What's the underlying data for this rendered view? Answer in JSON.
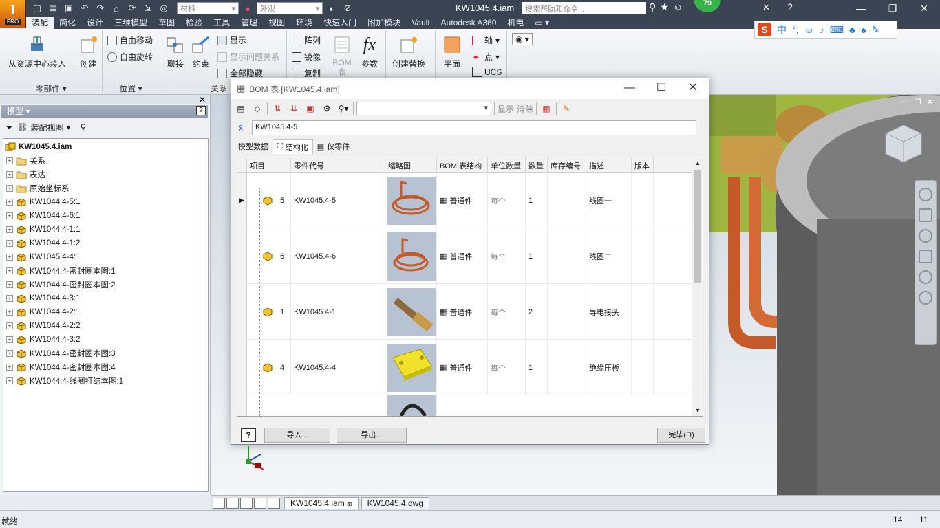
{
  "app": {
    "logo_letter": "I",
    "logo_pro": "PRO",
    "doc_title": "KW1045.4.iam",
    "search_placeholder": "搜索帮助和命令...",
    "badge": "79",
    "material_combo": "材料",
    "appearance_combo": "外观"
  },
  "menu": [
    "装配",
    "简化",
    "设计",
    "三维模型",
    "草图",
    "检验",
    "工具",
    "管理",
    "视图",
    "环境",
    "快速入门",
    "附加模块",
    "Vault",
    "Autodesk A360",
    "机电"
  ],
  "ribbon": {
    "place_from_center": "从资源中心装入",
    "create": "创建",
    "free_move": "自由移动",
    "free_rotate": "自由旋转",
    "joint": "联接",
    "constrain": "约束",
    "show": "显示",
    "show_problem": "显示问题关系",
    "hide_all": "全部隐藏",
    "pattern": "阵列",
    "mirror": "镜像",
    "copy": "复制",
    "bom": "BOM",
    "bom2": "表",
    "params": "参数",
    "create_sub": "创建替换",
    "plane": "平面",
    "axis": "轴",
    "point": "点",
    "ucs": "UCS",
    "panel_component": "零部件",
    "panel_position": "位置",
    "panel_relation": "关系"
  },
  "ime": {
    "logo": "S",
    "lang": "中"
  },
  "browser": {
    "title": "模型",
    "view": "装配视图",
    "root": "KW1045.4.iam",
    "items": [
      "关系",
      "表达",
      "原始坐标系",
      "KW1044.4-5:1",
      "KW1044.4-6:1",
      "KW1044.4-1:1",
      "KW1044.4-1:2",
      "KW1045.4-4:1",
      "KW1044.4-密封圈本图:1",
      "KW1044.4-密封圈本图:2",
      "KW1044.4-3:1",
      "KW1044.4-2:1",
      "KW1044.4-2:2",
      "KW1044.4-3:2",
      "KW1044.4-密封圈本图:3",
      "KW1044.4-密封圈本图:4",
      "KW1044.4-线圈打结本图:1"
    ]
  },
  "bom": {
    "title": "BOM 表 [KW1045.4.iam]",
    "toolbar_show": "显示",
    "toolbar_clear": "清除",
    "filter_value": "KW1045.4-5",
    "tabs": [
      "模型数据",
      "结构化",
      "仅零件"
    ],
    "columns": [
      "项目",
      "零件代号",
      "缩略图",
      "BOM 表结构",
      "单位数量",
      "数量",
      "库存编号",
      "描述",
      "版本"
    ],
    "rows": [
      {
        "item": "5",
        "part": "KW1045.4-5",
        "structure": "普通件",
        "unit": "每个",
        "qty": "1",
        "desc": "线圈一"
      },
      {
        "item": "6",
        "part": "KW1045.4-6",
        "structure": "普通件",
        "unit": "每个",
        "qty": "1",
        "desc": "线圈二"
      },
      {
        "item": "1",
        "part": "KW1045.4-1",
        "structure": "普通件",
        "unit": "每个",
        "qty": "2",
        "desc": "导电接头"
      },
      {
        "item": "4",
        "part": "KW1045.4-4",
        "structure": "普通件",
        "unit": "每个",
        "qty": "1",
        "desc": "绝缘压板"
      }
    ],
    "import_btn": "导入...",
    "export_btn": "导出...",
    "done_btn": "完毕(D)"
  },
  "doc_tabs": [
    "KW1045.4.iam",
    "KW1045.4.dwg"
  ],
  "status": {
    "text": "就绪",
    "num1": "14",
    "num2": "11"
  },
  "colors": {
    "accent": "#3a4452",
    "copper": "#c85a2a",
    "part_yellow": "#f0c419"
  }
}
